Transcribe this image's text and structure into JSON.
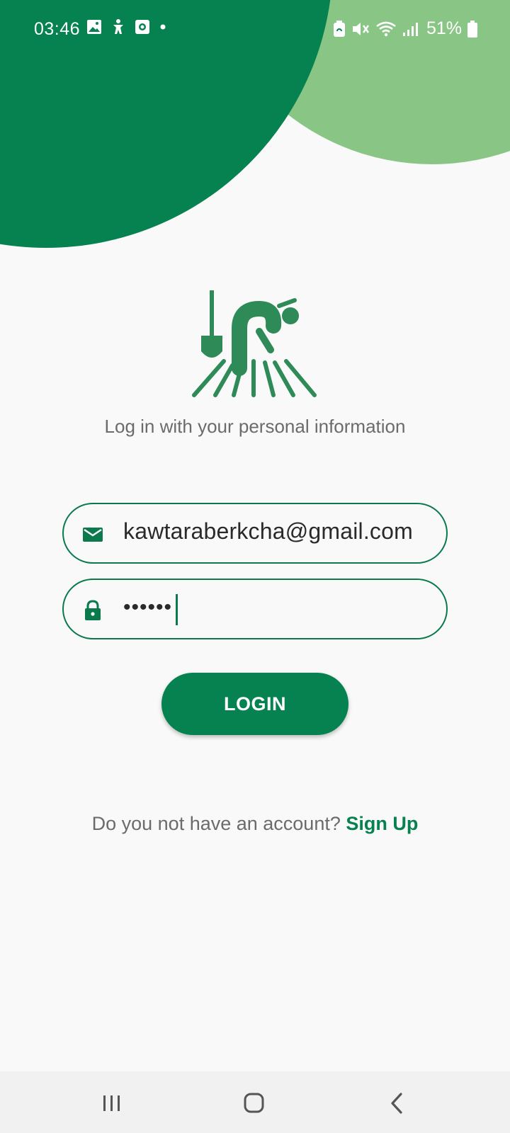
{
  "status_bar": {
    "time": "03:46",
    "battery_percent": "51%",
    "left_icons": [
      "image-icon",
      "accessibility-icon",
      "screen-record-icon",
      "dot-icon"
    ],
    "right_icons": [
      "battery-saver-icon",
      "mute-icon",
      "wifi-icon",
      "signal-icon",
      "battery-icon"
    ]
  },
  "login": {
    "subtitle": "Log in with your personal information",
    "email_value": "kawtaraberkcha@gmail.com",
    "password_value": "••••••",
    "button_label": "LOGIN"
  },
  "signup": {
    "prompt": "Do you not have an account?",
    "link": "Sign Up"
  },
  "colors": {
    "primary": "#068150",
    "accent_light": "#89c685",
    "background": "#f9f9f9",
    "text_muted": "#6b6b6b"
  },
  "nav_bar": {
    "buttons": [
      "recent-apps-icon",
      "home-icon",
      "back-icon"
    ]
  }
}
